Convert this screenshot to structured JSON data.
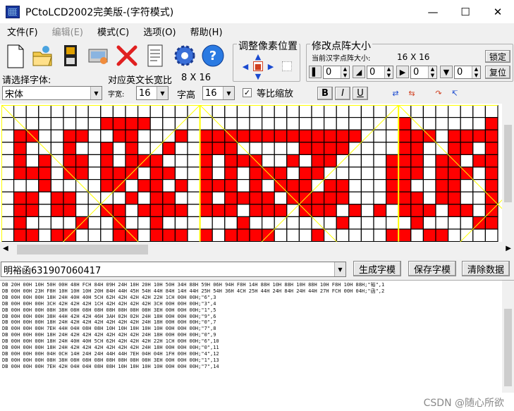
{
  "window": {
    "title": "PCtoLCD2002完美版-(字符模式)"
  },
  "menu": [
    "文件(F)",
    "编辑(E)",
    "模式(C)",
    "选项(O)",
    "帮助(H)"
  ],
  "toolbar_icons": [
    "new-file-icon",
    "open-folder-icon",
    "save-disk-icon",
    "settings-icon",
    "delete-x-icon",
    "notes-icon",
    "gear-icon",
    "help-icon"
  ],
  "pixel_group": {
    "title": "调整像素位置"
  },
  "dot_group": {
    "title": "修改点阵大小",
    "subtitle": "当前汉字点阵大小:",
    "size_value": "16 X 16",
    "lock_label": "锁定",
    "reset_label": "复位",
    "spinners": [
      "0",
      "0",
      "0",
      "0"
    ]
  },
  "font_select": {
    "label": "请选择字体:",
    "value": "宋体"
  },
  "ratio": {
    "label": "对应英文长宽比",
    "value": "8 X 16"
  },
  "width": {
    "label": "字宽:",
    "value": "16"
  },
  "height": {
    "label": "字高",
    "value": "16"
  },
  "proportional": {
    "label": "等比缩放",
    "checked": true
  },
  "style_buttons": [
    "B",
    "I",
    "U"
  ],
  "input": {
    "value": "明裕函631907060417"
  },
  "actions": {
    "generate": "生成字模",
    "save": "保存字模",
    "clear": "清除数据"
  },
  "output_lines": [
    "DB 20H 00H 10H 50H 00H 48H FCH 84H 09H 24H 10H 20H 10H 50H 34H 88H 59H 06H 94H F8H 14H 88H 10H 88H 10H 88H 10H F8H 10H 88H;\"裕\",1",
    "DB 00H 00H 23H F8H 10H 10H 10H 20H 84H 44H 45H 54H 44H 84H 14H 44H 25H 54H 36H 4CH 25H 44H 24H 84H 24H 44H 27H FCH 00H 04H;\"函\",2",
    "DB 00H 00H 00H 18H 24H 40H 40H 5CH 62H 42H 42H 42H 22H 1CH 00H 00H;\"6\",3",
    "DB 00H 00H 00H 3CH 42H 42H 42H 1CH 42H 42H 42H 42H 3CH 00H 00H 00H;\"3\",4",
    "DB 00H 00H 00H 08H 38H 08H 08H 08H 08H 08H 08H 08H 3EH 00H 00H 00H;\"1\",5",
    "DB 00H 00H 00H 38H 44H 42H 42H 46H 3AH 02H 02H 24H 18H 00H 00H 00H;\"9\",6",
    "DB 00H 00H 00H 18H 24H 42H 42H 42H 42H 42H 42H 24H 18H 00H 00H 00H;\"0\",7",
    "DB 00H 00H 00H 7EH 44H 04H 08H 08H 10H 10H 10H 10H 10H 00H 00H 00H;\"7\",8",
    "DB 00H 00H 00H 18H 24H 42H 42H 42H 42H 42H 42H 24H 18H 00H 00H 00H;\"0\",9",
    "DB 00H 00H 00H 18H 24H 40H 40H 5CH 62H 42H 42H 42H 22H 1CH 00H 00H;\"6\",10",
    "DB 00H 00H 00H 18H 24H 42H 42H 42H 42H 42H 42H 24H 18H 00H 00H 00H;\"0\",11",
    "DB 00H 00H 00H 04H 0CH 14H 24H 24H 44H 44H 7EH 04H 04H 1FH 00H 00H;\"4\",12",
    "DB 00H 00H 00H 08H 38H 08H 08H 08H 08H 08H 08H 08H 3EH 00H 00H 00H;\"1\",13",
    "DB 00H 00H 00H 7EH 42H 04H 04H 08H 08H 10H 10H 10H 10H 00H 00H 00H;\"7\",14"
  ],
  "grid": {
    "cols": 40,
    "rows": 11,
    "rows_data": [
      "0000000000000000000000000000000000000000",
      "0000000011110000000000000000000010000001",
      "0110011001100010111111111111100011101111",
      "0100010010100100111000001111000011001101",
      "0101011010111000101110010110000111011011",
      "0111011011101100101011101100000111011101",
      "0001000011011010111010111011000110011001",
      "0110110000101100101111011111000111011001",
      "0110110011011110111011101110101011101101",
      "0100001001001000000100000001000001000011",
      "0110110001101110101111000100000110110000"
    ],
    "on_color": "#ff0000",
    "off_color": "#ffffff",
    "line_color": "#000000",
    "divider_color": "#ffff00"
  },
  "watermark": "CSDN @随心所欲"
}
